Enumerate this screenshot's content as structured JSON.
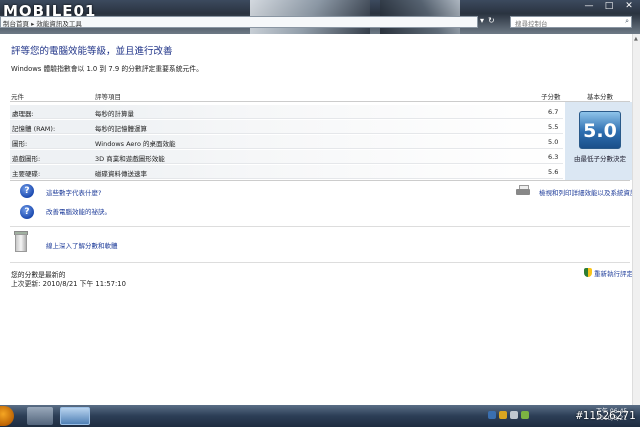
{
  "top": {
    "logo": "MOBILE01",
    "breadcrumb": "制台首頁 ▸ 效能資訊及工具",
    "nav_back": "▾",
    "nav_refresh": "↻",
    "search_placeholder": "搜尋控制台",
    "minimize": "—",
    "maximize": "□",
    "close": "✕"
  },
  "page": {
    "heading": "評等您的電腦效能等級，並且進行改善",
    "intro": "Windows 體驗指數會以 1.0 到 7.9 的分數評定重要系統元件。"
  },
  "table": {
    "headers": {
      "component": "元件",
      "rated": "評等項目",
      "subscore": "子分數",
      "base": "基本分數"
    },
    "rows": [
      {
        "component": "處理器:",
        "rated": "每秒的計算量",
        "score": "6.7"
      },
      {
        "component": "記憶體 (RAM):",
        "rated": "每秒的記憶體運算",
        "score": "5.5"
      },
      {
        "component": "圖形:",
        "rated": "Windows Aero 的桌面效能",
        "score": "5.0"
      },
      {
        "component": "遊戲圖形:",
        "rated": "3D 商業和遊戲圖形效能",
        "score": "6.3"
      },
      {
        "component": "主要硬碟:",
        "rated": "磁碟資料傳送速率",
        "score": "5.6"
      }
    ],
    "base_score": "5.0",
    "base_caption": "由最低子分數決定"
  },
  "links": {
    "what_mean": "這些數字代表什麼?",
    "improve": "改善電腦效能的祕訣。",
    "print": "檢視和列印詳細效能以及系統資訊",
    "learn_more": "線上深入了解分數和軟體"
  },
  "footer": {
    "status": "您的分數是最新的",
    "last_update": "上次更新: 2010/8/21 下午 11:57:10",
    "rerun": "重新執行評定"
  },
  "taskbar": {
    "clock_time": "下午 06:45",
    "clock_date": "2010/8/21"
  },
  "watermark": "#11526271"
}
